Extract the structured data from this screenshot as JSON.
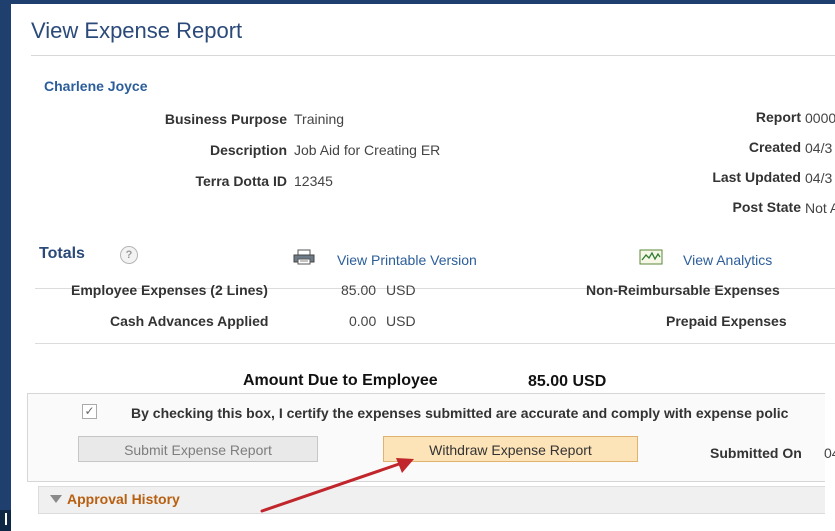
{
  "page_title": "View Expense Report",
  "employee_name": "Charlene Joyce",
  "details": {
    "business_purpose_label": "Business Purpose",
    "business_purpose_value": "Training",
    "description_label": "Description",
    "description_value": "Job Aid for Creating ER",
    "terra_label": "Terra Dotta ID",
    "terra_value": "12345",
    "report_label": "Report",
    "report_value": "0000",
    "created_label": "Created",
    "created_value": "04/3",
    "last_updated_label": "Last Updated",
    "last_updated_value": "04/3",
    "post_state_label": "Post State",
    "post_state_value": "Not A"
  },
  "totals": {
    "title": "Totals",
    "help_glyph": "?",
    "printable_link": "View Printable Version",
    "analytics_link": "View Analytics",
    "employee_expenses_label": "Employee Expenses (2 Lines)",
    "employee_expenses_value": "85.00",
    "employee_expenses_currency": "USD",
    "cash_advances_label": "Cash Advances Applied",
    "cash_advances_value": "0.00",
    "cash_advances_currency": "USD",
    "non_reimbursable_label": "Non-Reimbursable Expenses",
    "prepaid_label": "Prepaid Expenses",
    "amount_due_label": "Amount Due to Employee",
    "amount_due_value": "85.00  USD"
  },
  "certify": {
    "checked": true,
    "checkmark": "✓",
    "text": "By checking this box, I certify the expenses submitted are accurate and comply with expense polic"
  },
  "buttons": {
    "submit": "Submit Expense Report",
    "withdraw": "Withdraw Expense Report"
  },
  "submitted": {
    "label": "Submitted On",
    "value": "04"
  },
  "approval_history": {
    "title": "Approval History"
  },
  "icons": {
    "help": "help-icon",
    "print": "printer-icon",
    "analytics": "analytics-icon",
    "collapse": "triangle-down-icon",
    "annotation": "red-arrow-icon"
  },
  "colors": {
    "nav_bar": "#1f3f6e",
    "title": "#2b4a7a",
    "link": "#2b5d9a",
    "withdraw_button": "#fde3b8",
    "approval_title": "#b85f10",
    "annotation_arrow": "#c0262b"
  }
}
